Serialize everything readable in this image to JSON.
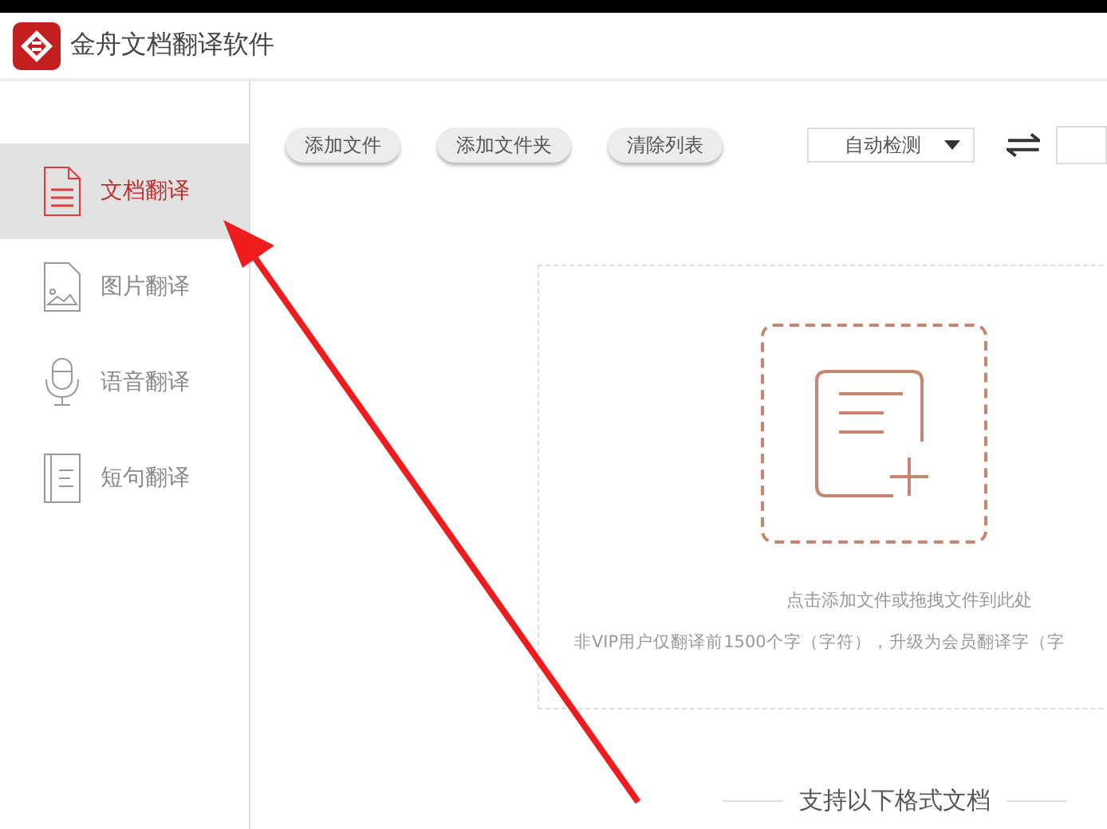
{
  "window": {
    "title": "金舟文档翻译软件"
  },
  "sidebar": {
    "items": [
      {
        "label": "文档翻译",
        "kind": "document",
        "selected": true
      },
      {
        "label": "图片翻译",
        "kind": "image",
        "selected": false
      },
      {
        "label": "语音翻译",
        "kind": "voice",
        "selected": false
      },
      {
        "label": "短句翻译",
        "kind": "sentence",
        "selected": false
      }
    ]
  },
  "toolbar": {
    "buttons": [
      "添加文件",
      "添加文件夹",
      "清除列表"
    ],
    "source_language": "自动检测"
  },
  "drop_zone": {
    "hint": "点击添加文件或拖拽文件到此处",
    "notice": "非VIP用户仅翻译前1500个字（字符），升级为会员翻译字（字"
  },
  "formats_heading": "支持以下格式文档"
}
